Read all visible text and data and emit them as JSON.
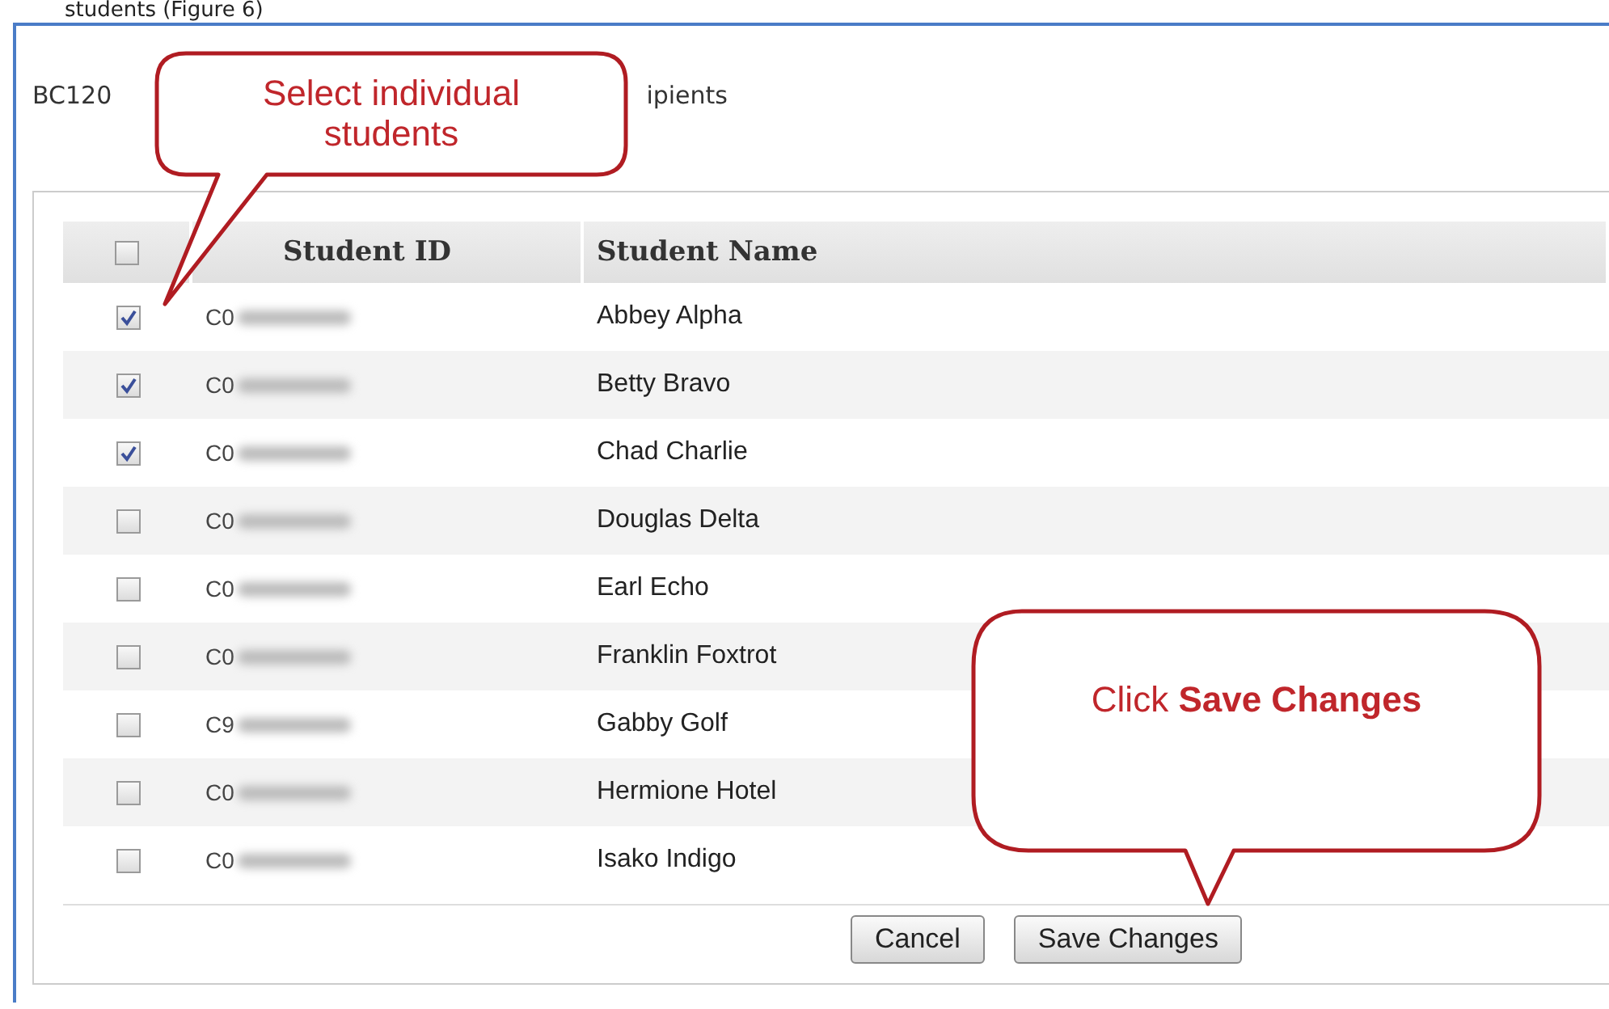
{
  "caption": "students (Figure 6)",
  "intro": {
    "before": "BC120",
    "after": "ipients"
  },
  "table": {
    "select_all": {
      "checked": false
    },
    "columns": [
      "Student ID",
      "Student Name"
    ],
    "rows": [
      {
        "checked": true,
        "id": "C0",
        "name": "Abbey Alpha"
      },
      {
        "checked": true,
        "id": "C0",
        "name": "Betty Bravo"
      },
      {
        "checked": true,
        "id": "C0",
        "name": "Chad Charlie"
      },
      {
        "checked": false,
        "id": "C0",
        "name": "Douglas Delta"
      },
      {
        "checked": false,
        "id": "C0",
        "name": "Earl Echo"
      },
      {
        "checked": false,
        "id": "C0",
        "name": "Franklin Foxtrot"
      },
      {
        "checked": false,
        "id": "C9",
        "name": "Gabby Golf"
      },
      {
        "checked": false,
        "id": "C0",
        "name": "Hermione Hotel"
      },
      {
        "checked": false,
        "id": "C0",
        "name": "Isako Indigo"
      }
    ]
  },
  "buttons": [
    "Cancel",
    "Save Changes"
  ],
  "callouts": [
    {
      "text": "Select individual students"
    },
    {
      "text": "Click **Save Changes**"
    }
  ]
}
